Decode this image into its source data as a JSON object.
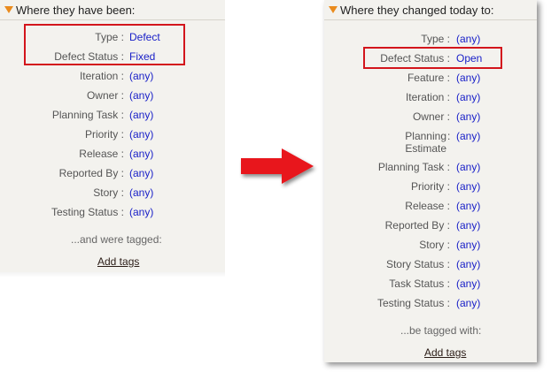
{
  "left": {
    "header": "Where they have been:",
    "rows": [
      {
        "label": "Type",
        "value": "Defect"
      },
      {
        "label": "Defect Status",
        "value": "Fixed"
      },
      {
        "label": "Iteration",
        "value": "(any)"
      },
      {
        "label": "Owner",
        "value": "(any)"
      },
      {
        "label": "Planning Task",
        "value": "(any)"
      },
      {
        "label": "Priority",
        "value": "(any)"
      },
      {
        "label": "Release",
        "value": "(any)"
      },
      {
        "label": "Reported By",
        "value": "(any)"
      },
      {
        "label": "Story",
        "value": "(any)"
      },
      {
        "label": "Testing Status",
        "value": "(any)"
      }
    ],
    "footer": "...and were tagged:",
    "add_tags": "Add tags"
  },
  "right": {
    "header": "Where they changed today to:",
    "rows": [
      {
        "label": "Type",
        "value": "(any)"
      },
      {
        "label": "Defect Status",
        "value": "Open"
      },
      {
        "label": "Feature",
        "value": "(any)"
      },
      {
        "label": "Iteration",
        "value": "(any)"
      },
      {
        "label": "Owner",
        "value": "(any)"
      },
      {
        "label_lines": [
          "Planning",
          "Estimate"
        ],
        "value": "(any)"
      },
      {
        "label": "Planning Task",
        "value": "(any)"
      },
      {
        "label": "Priority",
        "value": "(any)"
      },
      {
        "label": "Release",
        "value": "(any)"
      },
      {
        "label": "Reported By",
        "value": "(any)"
      },
      {
        "label": "Story",
        "value": "(any)"
      },
      {
        "label": "Story Status",
        "value": "(any)"
      },
      {
        "label": "Task Status",
        "value": "(any)"
      },
      {
        "label": "Testing Status",
        "value": "(any)"
      }
    ],
    "footer": "...be tagged with:",
    "add_tags": "Add tags"
  },
  "separator": ":",
  "colors": {
    "panel_bg": "#f3f2ee",
    "value_link": "#1a21c8",
    "label": "#555555",
    "highlight": "#d3151c",
    "arrow": "#e8121c",
    "header_triangle": "#ea8b1d"
  },
  "icons": {
    "header": "triangle-down-icon",
    "transition": "right-arrow-icon"
  }
}
